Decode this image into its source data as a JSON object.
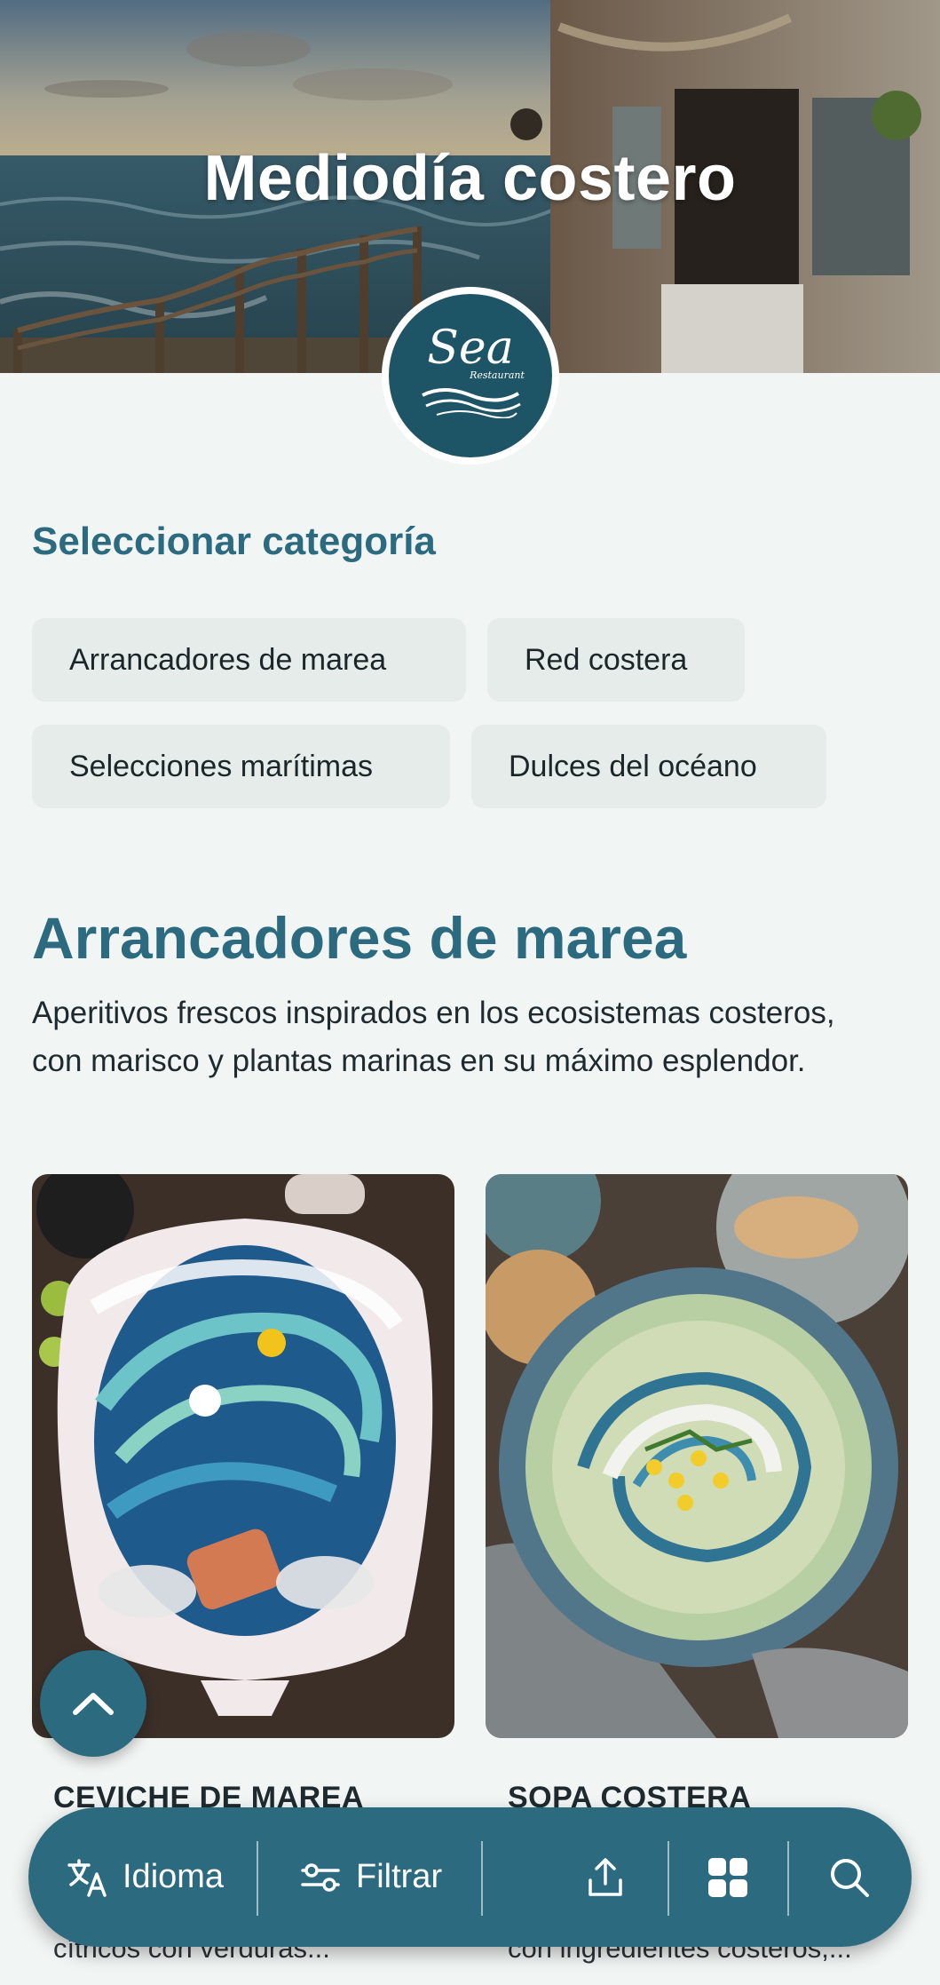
{
  "hero": {
    "title": "Mediodía costero",
    "logo_word": "Sea",
    "logo_sub": "Restaurant"
  },
  "categories": {
    "label": "Seleccionar categoría",
    "items": [
      {
        "label": "Arrancadores de marea"
      },
      {
        "label": "Red costera"
      },
      {
        "label": "Selecciones marítimas"
      },
      {
        "label": "Dulces del océano"
      }
    ]
  },
  "section": {
    "title": "Arrancadores de marea",
    "description": "Aperitivos frescos inspirados en los ecosistemas costeros, con marisco y plantas marinas en su máximo esplendor."
  },
  "dishes": [
    {
      "title": "CEVICHE DE MAREA",
      "desc": "cítricos con verduras...",
      "image_icon": "ceviche-plate-image"
    },
    {
      "title": "SOPA COSTERA",
      "desc": "con ingredientes costeros,...",
      "image_icon": "coastal-soup-image"
    }
  ],
  "bottom_bar": {
    "language_label": "Idioma",
    "filter_label": "Filtrar",
    "icons": [
      "translate-icon",
      "filter-icon",
      "share-icon",
      "grid-icon",
      "search-icon"
    ]
  },
  "colors": {
    "accent": "#2c6a80",
    "logo_bg": "#1e5566",
    "page_bg": "#f1f5f3",
    "chip_bg": "#e6ecea"
  }
}
